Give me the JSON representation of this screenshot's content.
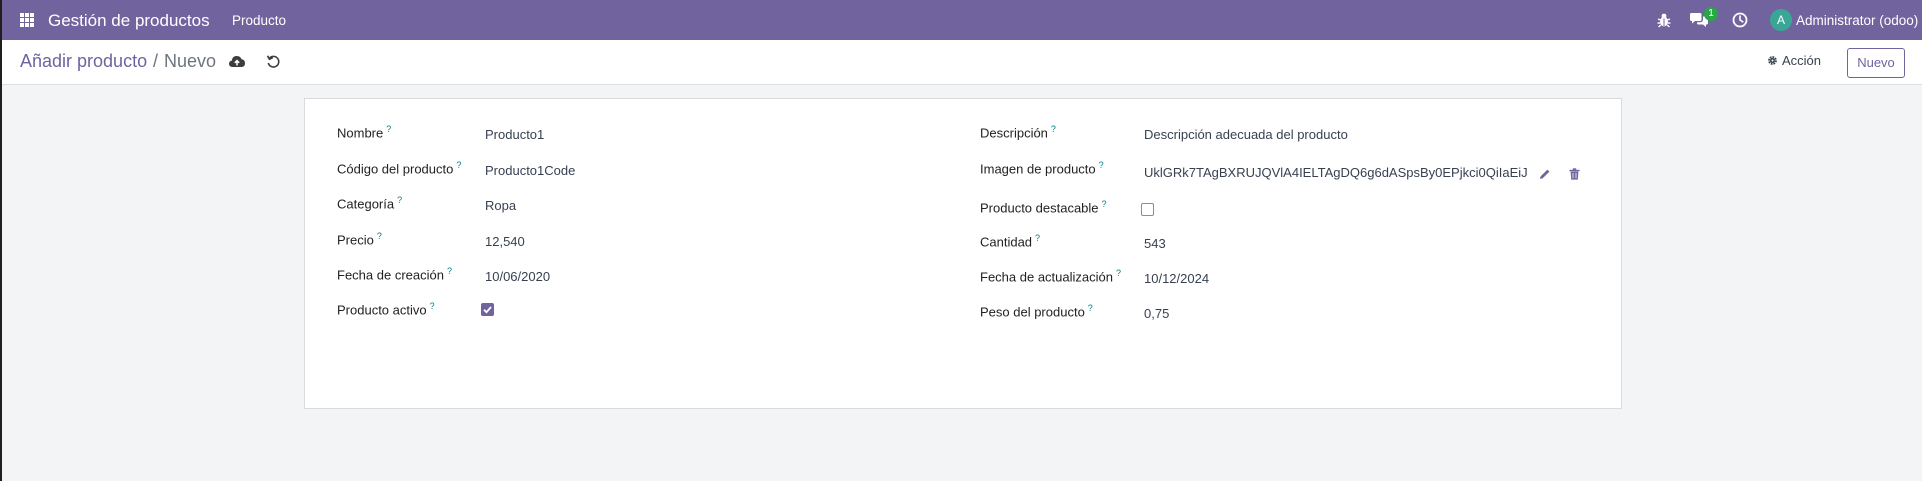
{
  "navbar": {
    "app_title": "Gestión de productos",
    "menu_item": "Producto",
    "chat_badge": "1",
    "avatar_letter": "A",
    "user_name": "Administrator (odoo)"
  },
  "control_panel": {
    "breadcrumb_parent": "Añadir producto",
    "breadcrumb_separator": "/",
    "breadcrumb_current": "Nuevo",
    "action_label": "Acción",
    "new_label": "Nuevo"
  },
  "form": {
    "left": [
      {
        "label": "Nombre",
        "value": "Producto1"
      },
      {
        "label": "Código del producto",
        "value": "Producto1Code"
      },
      {
        "label": "Categoría",
        "value": "Ropa"
      },
      {
        "label": "Precio",
        "value": "12,540"
      },
      {
        "label": "Fecha de creación",
        "value": "10/06/2020"
      },
      {
        "label": "Producto activo",
        "checked": true
      }
    ],
    "right": [
      {
        "label": "Descripción",
        "value": "Descripción adecuada del producto"
      },
      {
        "label": "Imagen de producto",
        "value": "UklGRk7TAgBXRUJQVlA4IELTAgDQ6g6dASpsBy0EPjkci0QiIaEiJ"
      },
      {
        "label": "Producto destacable",
        "checked": false
      },
      {
        "label": "Cantidad",
        "value": "543"
      },
      {
        "label": "Fecha de actualización",
        "value": "10/12/2024"
      },
      {
        "label": "Peso del producto",
        "value": "0,75"
      }
    ],
    "help_marker": "?"
  },
  "colors": {
    "brand": "#71639e",
    "help": "#017e84",
    "badge": "#28a745",
    "avatar": "#3aa796"
  }
}
